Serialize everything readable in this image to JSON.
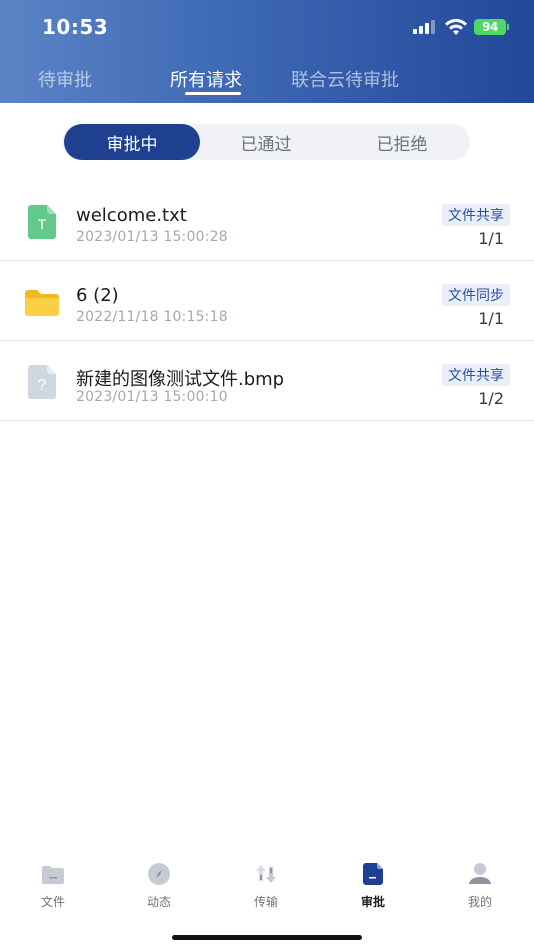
{
  "status_bar": {
    "time": "10:53",
    "battery": "94"
  },
  "top_tabs": [
    {
      "label": "待审批",
      "active": false
    },
    {
      "label": "所有请求",
      "active": true
    },
    {
      "label": "联合云待审批",
      "active": false
    }
  ],
  "segments": [
    {
      "label": "审批中",
      "active": true
    },
    {
      "label": "已通过",
      "active": false
    },
    {
      "label": "已拒绝",
      "active": false
    }
  ],
  "requests": [
    {
      "icon": "text-file-icon",
      "name": "welcome.txt",
      "date": "2023/01/13 15:00:28",
      "badge": "文件共享",
      "count": "1/1"
    },
    {
      "icon": "folder-icon",
      "name": "6 (2)",
      "date": "2022/11/18 10:15:18",
      "badge": "文件同步",
      "count": "1/1"
    },
    {
      "icon": "unknown-file-icon",
      "name": "新建的图像测试文件.bmp",
      "date": "2023/01/13 15:00:10",
      "badge": "文件共享",
      "count": "1/2"
    }
  ],
  "bottom_nav": [
    {
      "label": "文件",
      "icon": "folder-icon",
      "active": false
    },
    {
      "label": "动态",
      "icon": "compass-icon",
      "active": false
    },
    {
      "label": "传输",
      "icon": "transfer-icon",
      "active": false
    },
    {
      "label": "审批",
      "icon": "approval-icon",
      "active": true
    },
    {
      "label": "我的",
      "icon": "profile-icon",
      "active": false
    }
  ],
  "colors": {
    "header_start": "#5b84c6",
    "header_end": "#23489a",
    "accent": "#1f3f8f",
    "badge_bg": "#e9eef9",
    "badge_text": "#2a4fa6"
  }
}
